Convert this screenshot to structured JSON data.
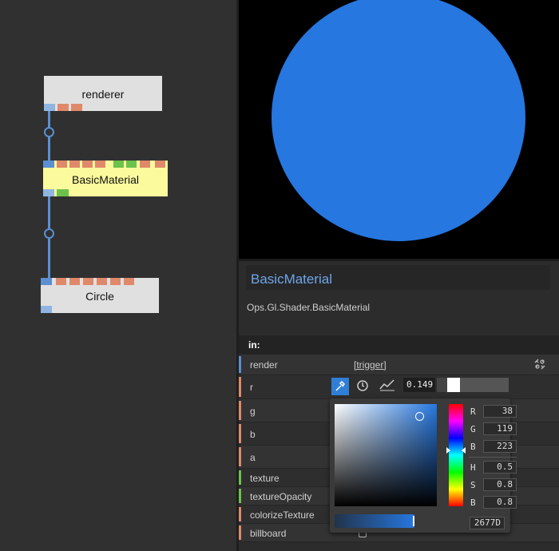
{
  "colors": {
    "circle_fill": "#2677df",
    "accent": "#6ea6ea",
    "port_orange": "#e0896a",
    "port_green": "#6cc24a",
    "port_blue": "#5b8fd0",
    "node_highlight": "#fbfa9d"
  },
  "graph": {
    "nodes": [
      {
        "id": "renderer",
        "title": "renderer"
      },
      {
        "id": "basicmaterial",
        "title": "BasicMaterial"
      },
      {
        "id": "circle",
        "title": "Circle"
      }
    ]
  },
  "panel": {
    "op_name": "BasicMaterial",
    "op_path": "Ops.Gl.Shader.BasicMaterial",
    "section_in": "in:",
    "params": [
      {
        "label": "render",
        "value": "[trigger]",
        "port": "trigger"
      },
      {
        "label": "r",
        "value": "0.149",
        "port": "number"
      },
      {
        "label": "g",
        "port": "number"
      },
      {
        "label": "b",
        "port": "number"
      },
      {
        "label": "a",
        "port": "number"
      },
      {
        "label": "texture",
        "port": "object"
      },
      {
        "label": "textureOpacity",
        "port": "object"
      },
      {
        "label": "colorizeTexture",
        "port": "number"
      },
      {
        "label": "billboard",
        "port": "number"
      }
    ],
    "r_slider": 0.149
  },
  "picker": {
    "rgb": {
      "R": "38",
      "G": "119",
      "B": "223"
    },
    "hsb": {
      "H": "0.5",
      "S": "0.8",
      "B": "0.8"
    },
    "hex": "2677D",
    "labels": {
      "r": "R",
      "g": "G",
      "b": "B",
      "h": "H",
      "s": "S",
      "bb": "B"
    }
  }
}
